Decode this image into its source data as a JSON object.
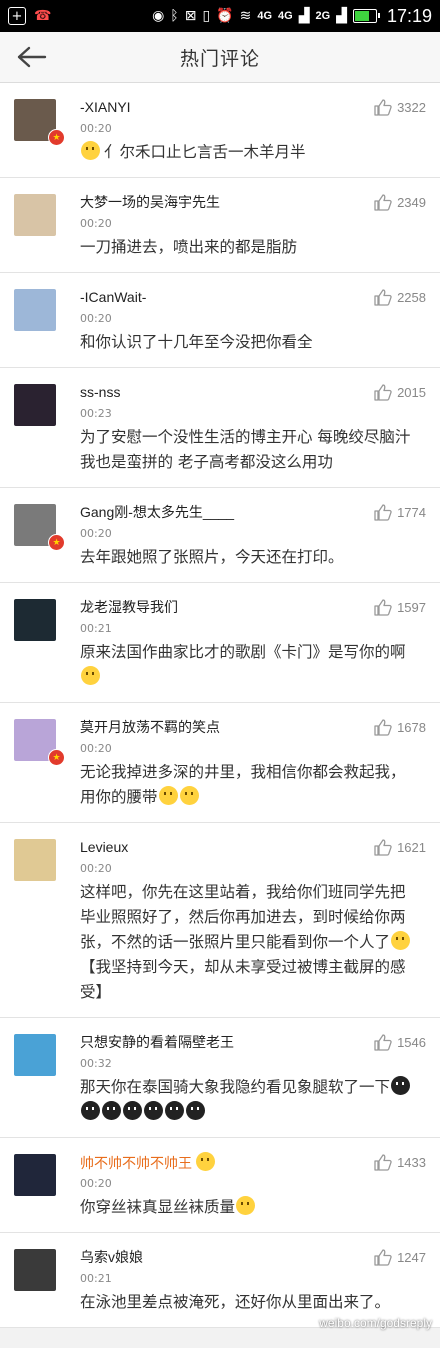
{
  "status_bar": {
    "network_left": "4G",
    "network_mid": "4G",
    "network_right": "2G",
    "time": "17:19",
    "battery_level": 0.8
  },
  "header": {
    "title": "热门评论"
  },
  "comments": [
    {
      "name": "-XIANYI",
      "time": "00:20",
      "likes": "3322",
      "text": "亻尔禾口止匕言舌一木羊月半",
      "emoji_before": true,
      "badge": true,
      "avatar_color": "#6a5a4c"
    },
    {
      "name": "大梦一场的吴海宇先生",
      "time": "00:20",
      "likes": "2349",
      "text": "一刀捅进去，喷出来的都是脂肪",
      "avatar_color": "#d8c4a6"
    },
    {
      "name": "-ICanWait-",
      "time": "00:20",
      "likes": "2258",
      "text": "和你认识了十几年至今没把你看全",
      "avatar_color": "#9db7d8"
    },
    {
      "name": "ss-nss",
      "time": "00:23",
      "likes": "2015",
      "text": "为了安慰一个没性生活的博主开心 每晚绞尽脑汁 我也是蛮拼的 老子高考都没这么用功",
      "avatar_color": "#2a2230"
    },
    {
      "name": "Gang刚-想太多先生____",
      "time": "00:20",
      "likes": "1774",
      "text": "去年跟她照了张照片，今天还在打印。",
      "badge": true,
      "avatar_color": "#7a7a7a"
    },
    {
      "name": "龙老湿教导我们",
      "time": "00:21",
      "likes": "1597",
      "text": "原来法国作曲家比才的歌剧《卡门》是写你的啊",
      "emoji_after": 1,
      "avatar_color": "#1d2a33"
    },
    {
      "name": "莫开月放荡不羁的笑点",
      "time": "00:20",
      "likes": "1678",
      "text": "无论我掉进多深的井里，我相信你都会救起我，用你的腰带",
      "emoji_after": 2,
      "badge": true,
      "avatar_color": "#b9a5d8"
    },
    {
      "name": "Levieux",
      "time": "00:20",
      "likes": "1621",
      "text": "这样吧，你先在这里站着，我给你们班同学先把毕业照照好了，然后你再加进去，到时候给你两张，不然的话一张照片里只能看到你一个人了",
      "emoji_after": 1,
      "text_after": "【我坚持到今天，却从未享受过被博主截屏的感受】",
      "avatar_color": "#e0c994"
    },
    {
      "name": "只想安静的看着隔壁老王",
      "time": "00:32",
      "likes": "1546",
      "text": "那天你在泰国骑大象我隐约看见象腿软了一下",
      "emoji_dark": 7,
      "avatar_color": "#4aa2d6"
    },
    {
      "name": "帅不帅不帅不帅王",
      "name_orange": true,
      "time": "00:20",
      "likes": "1433",
      "text": "你穿丝袜真显丝袜质量",
      "emoji_after": 1,
      "name_emoji": true,
      "avatar_color": "#20263a"
    },
    {
      "name": "乌索v娘娘",
      "time": "00:21",
      "likes": "1247",
      "text": "在泳池里差点被淹死，还好你从里面出来了。",
      "avatar_color": "#3a3a3a"
    }
  ],
  "watermark": "weibo.com/godsreply"
}
